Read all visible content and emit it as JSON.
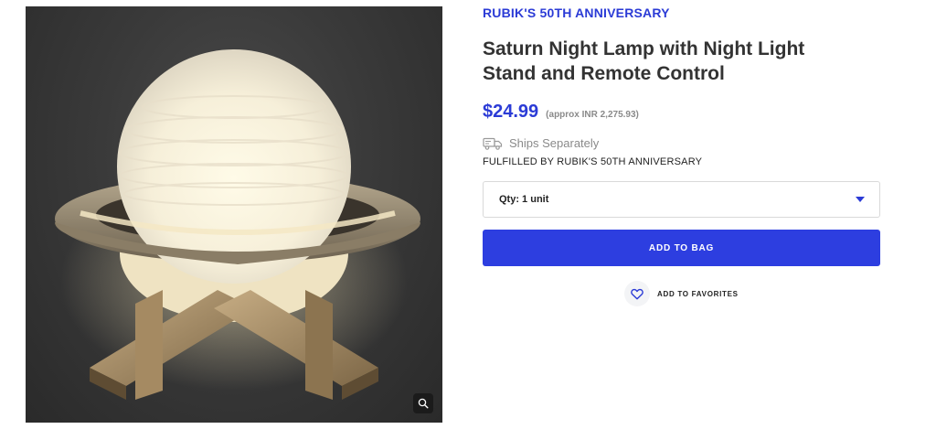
{
  "product": {
    "brand": "RUBIK'S 50TH ANNIVERSARY",
    "title_line1": "Saturn Night Lamp with Night Light",
    "title_line2": "Stand and Remote Control",
    "price": "$24.99",
    "approx_price": "(approx INR 2,275.93)",
    "ships_text": "Ships Separately",
    "fulfilled_by": "FULFILLED BY RUBIK'S 50TH ANNIVERSARY",
    "image_icon": "saturn-lamp-photo"
  },
  "quantity": {
    "selected": "Qty: 1 unit"
  },
  "actions": {
    "add_to_bag": "ADD TO BAG",
    "add_to_favorites": "ADD TO FAVORITES"
  },
  "icons": {
    "zoom": "zoom-icon",
    "truck": "truck-icon",
    "heart": "heart-icon",
    "dropdown": "chevron-down-icon"
  },
  "colors": {
    "accent": "#2b3bd6",
    "button": "#2d3ee0",
    "muted": "#8a8a8a"
  }
}
